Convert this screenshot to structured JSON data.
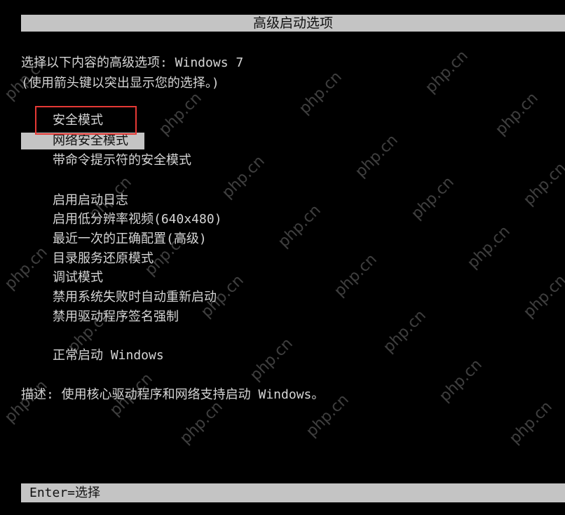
{
  "title": "高级启动选项",
  "prompt": {
    "line1": "选择以下内容的高级选项: Windows 7",
    "line2": "(使用箭头键以突出显示您的选择。)"
  },
  "menu": {
    "selected_index": 1,
    "items": [
      {
        "label": "安全模式"
      },
      {
        "label": "网络安全模式"
      },
      {
        "label": "带命令提示符的安全模式"
      },
      {
        "label": "启用启动日志"
      },
      {
        "label": "启用低分辨率视频(640x480)"
      },
      {
        "label": "最近一次的正确配置(高级)"
      },
      {
        "label": "目录服务还原模式"
      },
      {
        "label": "调试模式"
      },
      {
        "label": "禁用系统失败时自动重新启动"
      },
      {
        "label": "禁用驱动程序签名强制"
      },
      {
        "label": "正常启动 Windows"
      }
    ]
  },
  "description": "描述: 使用核心驱动程序和网络支持启动 Windows。",
  "status_bar": "Enter=选择",
  "watermark_text": "php.cn",
  "colors": {
    "background": "#000000",
    "text": "#d6d6d6",
    "bar": "#c4c4c4",
    "annotation_box": "#e53935"
  }
}
